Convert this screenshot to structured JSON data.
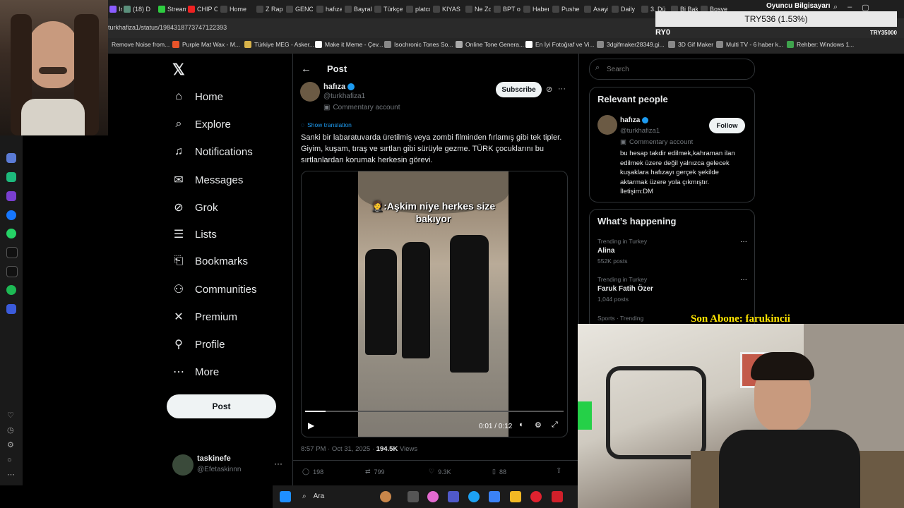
{
  "browser": {
    "tabs": [
      {
        "label": "Ins",
        "color": "#8a5cff"
      },
      {
        "label": "(18) D",
        "color": "#5a8f7b"
      },
      {
        "label": "Stream",
        "color": "#2ecc40"
      },
      {
        "label": "CHIP C",
        "color": "#e22"
      },
      {
        "label": "Home",
        "color": "#444"
      },
      {
        "label": "Z Rap",
        "color": "#444"
      },
      {
        "label": "GENC",
        "color": "#444"
      },
      {
        "label": "hafıza",
        "color": "#444"
      },
      {
        "label": "Bayrak",
        "color": "#444"
      },
      {
        "label": "Türkçe",
        "color": "#444"
      },
      {
        "label": "platco",
        "color": "#444"
      },
      {
        "label": "KIYAS",
        "color": "#444"
      },
      {
        "label": "Ne Zo",
        "color": "#444"
      },
      {
        "label": "BPT o",
        "color": "#444"
      },
      {
        "label": "Haber",
        "color": "#444"
      },
      {
        "label": "Pushe",
        "color": "#444"
      },
      {
        "label": "Asayiş",
        "color": "#444"
      },
      {
        "label": "Daily",
        "color": "#444"
      },
      {
        "label": "3. Dü",
        "color": "#444"
      },
      {
        "label": "Bi Bak",
        "color": "#444"
      },
      {
        "label": "Boşve",
        "color": "#444"
      }
    ],
    "url": "turkhafiza1/status/1984318773747122393",
    "bookmarks": [
      {
        "label": "Remove Noise from...",
        "color": "#999"
      },
      {
        "label": "Purple Mat Wax - M...",
        "color": "#e8542a"
      },
      {
        "label": "Türkiye MEG - Asker...",
        "color": "#d8b34a"
      },
      {
        "label": "Make it Meme - Çev...",
        "color": "#fff"
      },
      {
        "label": "Isochronic Tones So...",
        "color": "#888"
      },
      {
        "label": "Online Tone Genera...",
        "color": "#aaa"
      },
      {
        "label": "En İyi Fotoğraf ve Vi...",
        "color": "#fff"
      },
      {
        "label": "3dgifmaker28349.gi...",
        "color": "#888"
      },
      {
        "label": "3D Gif Maker",
        "color": "#888"
      },
      {
        "label": "Multi TV - 6 haber k...",
        "color": "#888"
      },
      {
        "label": "Rehber: Windows 1...",
        "color": "#3fa34d"
      }
    ],
    "overlay_top": "Oyuncu Bilgisayarı",
    "overlay_left": "RY0",
    "overlay_right": "TRY35000",
    "ticker": "TRY536 (1.53%)"
  },
  "nav": {
    "items": [
      {
        "label": "Home",
        "icon": "home-icon"
      },
      {
        "label": "Explore",
        "icon": "search-icon"
      },
      {
        "label": "Notifications",
        "icon": "bell-icon"
      },
      {
        "label": "Messages",
        "icon": "mail-icon"
      },
      {
        "label": "Grok",
        "icon": "grok-icon"
      },
      {
        "label": "Lists",
        "icon": "list-icon"
      },
      {
        "label": "Bookmarks",
        "icon": "bookmark-icon"
      },
      {
        "label": "Communities",
        "icon": "people-icon"
      },
      {
        "label": "Premium",
        "icon": "x-icon"
      },
      {
        "label": "Profile",
        "icon": "person-icon"
      },
      {
        "label": "More",
        "icon": "more-circle-icon"
      }
    ],
    "post_button": "Post",
    "account": {
      "name": "taskinefe",
      "handle": "@Efetaskinnn"
    }
  },
  "post": {
    "header_title": "Post",
    "author_name": "hafıza",
    "author_handle": "@turkhafiza1",
    "commentary": "Commentary account",
    "subscribe_label": "Subscribe",
    "show_translation": "Show translation",
    "text": "Sanki bir labaratuvarda üretilmiş veya zombi filminden fırlamış gibi tek tipler. Giyim, kuşam, tıraş ve sırtlan gibi sürüyle gezme. TÜRK çocuklarını bu sırtlanlardan korumak herkesin görevi.",
    "video_caption": "🤵:Aşkim niye herkes size bakıyor",
    "video_time": "0:01 / 0:12",
    "video_progress": 0.08,
    "timestamp": "8:57 PM · Oct 31, 2025 · ",
    "views_count": "194.5K",
    "views_label": " Views",
    "replies": "198",
    "reposts": "799",
    "likes": "9.3K",
    "bookmarks": "88"
  },
  "right": {
    "search_placeholder": "Search",
    "relevant_title": "Relevant people",
    "person": {
      "name": "hafıza",
      "handle": "@turkhafiza1",
      "commentary": "Commentary account",
      "follow_label": "Follow",
      "bio": "bu hesap takdir edilmek,kahraman ilan edilmek üzere değil yalnızca gelecek kuşaklara hafızayı gerçek şekilde aktarmak üzere yola çıkmıştır. İletişim:DM"
    },
    "happening_title": "What’s happening",
    "trends": [
      {
        "context": "Trending in Turkey",
        "name": "Alina",
        "count": "552K posts"
      },
      {
        "context": "Trending in Turkey",
        "name": "Faruk Fatih Özer",
        "count": "1,044 posts"
      },
      {
        "context": "Sports · Trending",
        "name": "",
        "count": ""
      }
    ]
  },
  "stream": {
    "son_abone": "Son Abone: farukincii"
  },
  "taskbar": {
    "search_label": "Ara"
  }
}
